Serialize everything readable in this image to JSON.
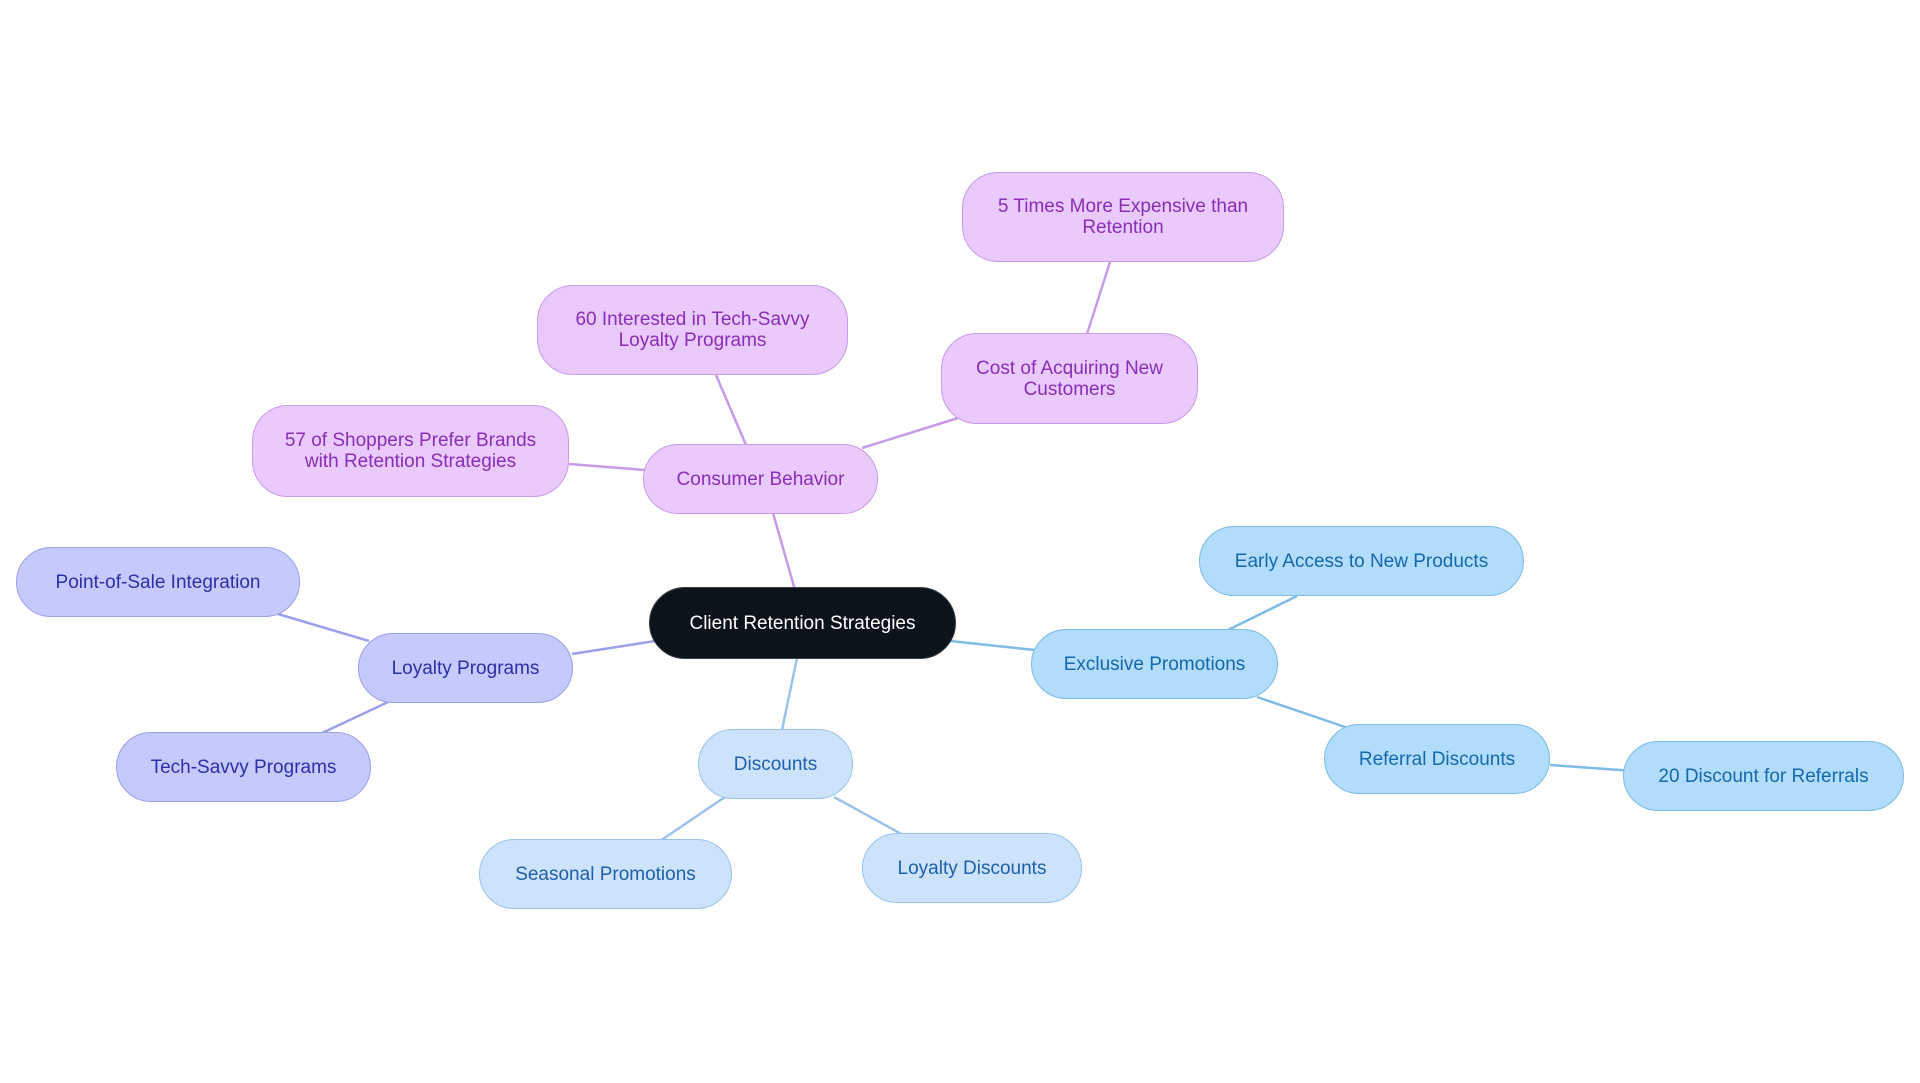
{
  "diagram": {
    "type": "mind-map",
    "root": {
      "id": "root",
      "label": "Client Retention Strategies"
    },
    "colors": {
      "root_fill": "#0d131b",
      "consumer_behavior": {
        "fill": "#eac9fd",
        "stroke": "#c99be8",
        "text": "#8a2db9",
        "edge": "#c89be8"
      },
      "loyalty_programs": {
        "fill": "#c6c9fb",
        "stroke": "#9aa0ea",
        "text": "#2b30a8",
        "edge": "#9aa0ea"
      },
      "discounts": {
        "fill": "#cce3fb",
        "stroke": "#9ac2ea",
        "text": "#1e5fae",
        "edge": "#9ac2ea"
      },
      "exclusive_promotions": {
        "fill": "#b1dcfb",
        "stroke": "#7ebbe6",
        "text": "#1468ad",
        "edge": "#7ebbe6"
      }
    },
    "nodes": [
      {
        "id": "consumer",
        "label": "Consumer Behavior",
        "parent": "root"
      },
      {
        "id": "cost",
        "label": "Cost of Acquiring New\nCustomers",
        "parent": "consumer"
      },
      {
        "id": "fivetimes",
        "label": "5 Times More Expensive than\nRetention",
        "parent": "cost"
      },
      {
        "id": "sixty",
        "label": "60 Interested in Tech-Savvy\nLoyalty Programs",
        "parent": "consumer"
      },
      {
        "id": "fiftyseven",
        "label": "57 of Shoppers Prefer Brands\nwith Retention Strategies",
        "parent": "consumer"
      },
      {
        "id": "loyalty",
        "label": "Loyalty Programs",
        "parent": "root"
      },
      {
        "id": "pos",
        "label": "Point-of-Sale Integration",
        "parent": "loyalty"
      },
      {
        "id": "techsavvy",
        "label": "Tech-Savvy Programs",
        "parent": "loyalty"
      },
      {
        "id": "discounts",
        "label": "Discounts",
        "parent": "root"
      },
      {
        "id": "seasonal",
        "label": "Seasonal Promotions",
        "parent": "discounts"
      },
      {
        "id": "loyaltydisc",
        "label": "Loyalty Discounts",
        "parent": "discounts"
      },
      {
        "id": "exclusive",
        "label": "Exclusive Promotions",
        "parent": "root"
      },
      {
        "id": "early",
        "label": "Early Access to New Products",
        "parent": "exclusive"
      },
      {
        "id": "referral",
        "label": "Referral Discounts",
        "parent": "exclusive"
      },
      {
        "id": "twenty",
        "label": "20 Discount for Referrals",
        "parent": "referral"
      }
    ]
  }
}
